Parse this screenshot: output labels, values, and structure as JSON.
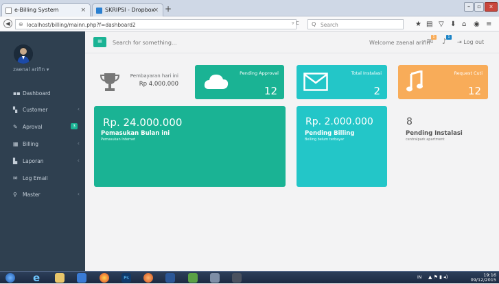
{
  "browser": {
    "tabs": [
      {
        "label": "e-Billing System"
      },
      {
        "label": "SKRIPSI - Dropbox"
      }
    ],
    "new_tab": "+",
    "url": "localhost/billing/mainn.php?f=dashboard2",
    "search_placeholder": "Search"
  },
  "sidebar": {
    "user_name": "zaenal arifin ▾",
    "items": [
      {
        "label": "Dashboard",
        "icon": "dashboard-icon",
        "chevron": ""
      },
      {
        "label": "Customer",
        "icon": "customer-icon",
        "chevron": "‹"
      },
      {
        "label": "Aproval",
        "icon": "approval-icon",
        "badge": "3"
      },
      {
        "label": "Billing",
        "icon": "billing-icon",
        "chevron": "‹"
      },
      {
        "label": "Laporan",
        "icon": "report-icon",
        "chevron": "‹"
      },
      {
        "label": "Log Email",
        "icon": "email-icon",
        "chevron": ""
      },
      {
        "label": "Master",
        "icon": "master-icon",
        "chevron": "‹"
      }
    ]
  },
  "topbar": {
    "search_placeholder": "Search for something...",
    "welcome": "Welcome zaenal arifin",
    "notif_badge_1": "1",
    "notif_badge_2": "1",
    "logout": "Log out"
  },
  "widgets": {
    "income_today": {
      "label": "Pembayaran hari ini",
      "value": "Rp 4.000.000"
    },
    "pending_approval": {
      "label": "Pending Approval",
      "value": "12",
      "color": "#1ab394"
    },
    "total_instalasi": {
      "label": "Total Instalasi",
      "value": "2",
      "color": "#23c6c8"
    },
    "request_cuti": {
      "label": "Request Cuti",
      "value": "12",
      "color": "#f8ac59"
    }
  },
  "stats": {
    "pemasukan": {
      "amount": "Rp. 24.000.000",
      "title": "Pemasukan Bulan ini",
      "sub": "Pemasukan Internet",
      "color": "#1ab394"
    },
    "pending_billing": {
      "amount": "Rp. 2.000.000",
      "title": "Pending Billing",
      "sub": "Belling belum terbayar",
      "color": "#23c6c8"
    },
    "pending_instalasi": {
      "count": "8",
      "title": "Pending Instalasi",
      "sub": "centralpark apartment"
    }
  },
  "taskbar": {
    "lang": "IN",
    "time": "19:16",
    "date": "09/12/2015"
  }
}
